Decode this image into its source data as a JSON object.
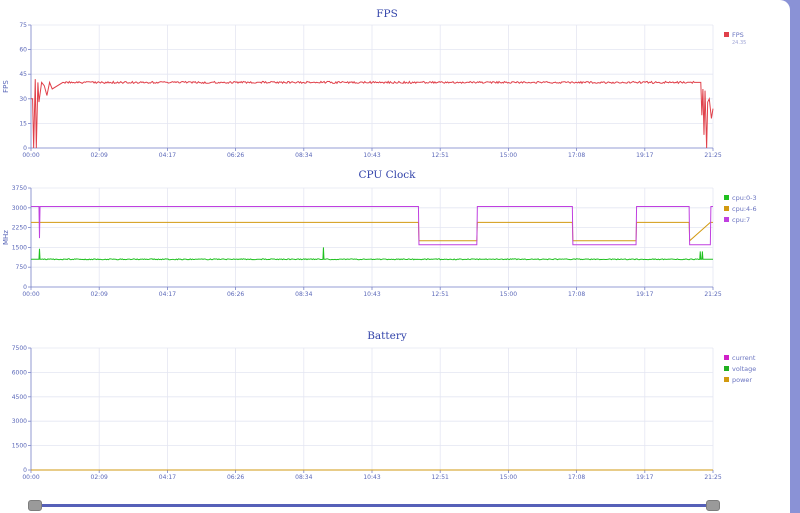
{
  "chart_data": [
    {
      "type": "line",
      "title": "FPS",
      "ylabel": "FPS",
      "ylim": [
        0,
        75
      ],
      "yticks": [
        "0",
        "15",
        "30",
        "45",
        "60",
        "75"
      ],
      "xtick_labels": [
        "00:00",
        "02:09",
        "04:17",
        "06:26",
        "08:34",
        "10:43",
        "12:51",
        "15:00",
        "17:08",
        "19:17",
        "21:25"
      ],
      "legend_value": "24.35",
      "series": [
        {
          "name": "FPS",
          "color": "#e0404a",
          "x": [
            "00:00",
            "00:03",
            "00:05",
            "00:08",
            "00:10",
            "00:13",
            "00:15",
            "00:20",
            "00:25",
            "00:30",
            "00:35",
            "00:40",
            "01:00",
            "02:09",
            "04:17",
            "06:26",
            "08:34",
            "10:43",
            "12:51",
            "15:00",
            "17:08",
            "19:17",
            "20:50",
            "21:00",
            "21:02",
            "21:04",
            "21:06",
            "21:08",
            "21:10",
            "21:13",
            "21:15",
            "21:18",
            "21:22",
            "21:25"
          ],
          "values": [
            30,
            30,
            0,
            42,
            0,
            40,
            28,
            40,
            38,
            32,
            40,
            36,
            40,
            40,
            40,
            40,
            40,
            40,
            40,
            40,
            40,
            40,
            40,
            40,
            40,
            20,
            36,
            8,
            35,
            0,
            28,
            30,
            18,
            24
          ]
        }
      ]
    },
    {
      "type": "line",
      "title": "CPU Clock",
      "ylabel": "MHz",
      "ylim": [
        0,
        3750
      ],
      "yticks": [
        "0",
        "750",
        "1500",
        "2250",
        "3000",
        "3750"
      ],
      "xtick_labels": [
        "00:00",
        "02:09",
        "04:17",
        "06:26",
        "08:34",
        "10:43",
        "12:51",
        "15:00",
        "17:08",
        "19:17",
        "21:25"
      ],
      "series": [
        {
          "name": "cpu:0-3",
          "color": "#20c020",
          "x": [
            "00:00",
            "00:15",
            "00:16",
            "00:17",
            "00:20",
            "09:10",
            "09:11",
            "09:12",
            "09:15",
            "21:00",
            "21:01",
            "21:02",
            "21:04",
            "21:05",
            "21:06",
            "21:08",
            "21:25"
          ],
          "values": [
            1050,
            1050,
            1450,
            1050,
            1050,
            1050,
            1500,
            1050,
            1050,
            1050,
            1350,
            1050,
            1050,
            1350,
            1050,
            1050,
            1050
          ]
        },
        {
          "name": "cpu:4-6",
          "color": "#d29a10",
          "x": [
            "00:00",
            "12:10",
            "12:11",
            "14:00",
            "14:01",
            "17:00",
            "17:01",
            "19:00",
            "19:01",
            "20:40",
            "20:41",
            "21:20",
            "21:25"
          ],
          "values": [
            2450,
            2450,
            1750,
            1750,
            2450,
            2450,
            1750,
            1750,
            2450,
            2450,
            1750,
            2450,
            2450
          ]
        },
        {
          "name": "cpu:7",
          "color": "#c040e0",
          "x": [
            "00:00",
            "00:15",
            "00:16",
            "00:17",
            "12:10",
            "12:11",
            "14:00",
            "14:01",
            "17:00",
            "17:01",
            "19:00",
            "19:01",
            "20:40",
            "20:41",
            "21:20",
            "21:21",
            "21:25"
          ],
          "values": [
            3050,
            3050,
            1850,
            3050,
            3050,
            1600,
            1600,
            3050,
            3050,
            1600,
            1600,
            3050,
            3050,
            1600,
            1600,
            3050,
            3050
          ]
        }
      ]
    },
    {
      "type": "line",
      "title": "Battery",
      "ylabel": "",
      "ylim": [
        0,
        7500
      ],
      "yticks": [
        "0",
        "1500",
        "3000",
        "4500",
        "6000",
        "7500"
      ],
      "xtick_labels": [
        "00:00",
        "02:09",
        "04:17",
        "06:26",
        "08:34",
        "10:43",
        "12:51",
        "15:00",
        "17:08",
        "19:17",
        "21:25"
      ],
      "series": [
        {
          "name": "current",
          "color": "#d020c8",
          "x": [
            "00:00",
            "21:25"
          ],
          "values": [
            0,
            0
          ]
        },
        {
          "name": "voltage",
          "color": "#20b020",
          "x": [
            "00:00",
            "21:25"
          ],
          "values": [
            0,
            0
          ]
        },
        {
          "name": "power",
          "color": "#d29a10",
          "x": [
            "00:00",
            "21:25"
          ],
          "values": [
            0,
            0
          ]
        }
      ]
    }
  ],
  "slider": {
    "start": 0,
    "end": 1
  }
}
